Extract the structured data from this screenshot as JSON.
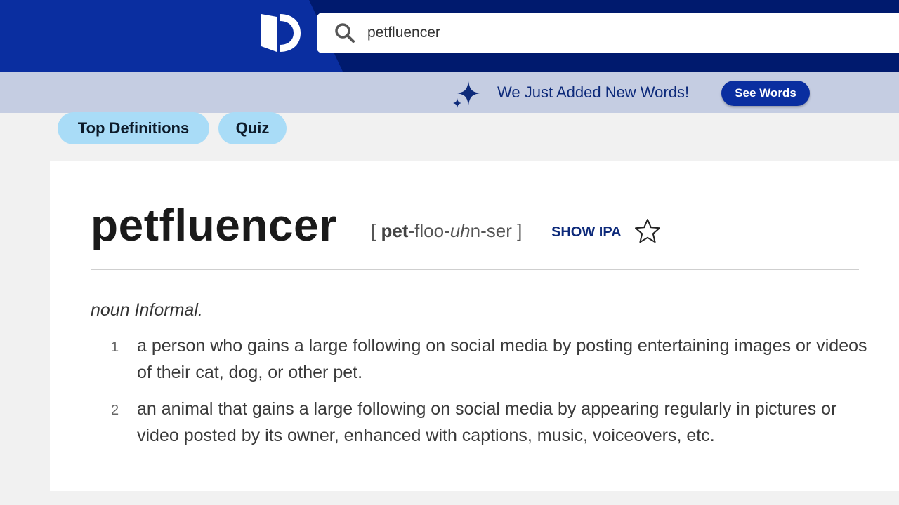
{
  "header": {
    "search": {
      "value": "petfluencer",
      "icon": "search-icon"
    },
    "logo_icon": "dictionary-logo-icon",
    "colors": {
      "primary": "#0a2ea0",
      "dark": "#001a6e"
    }
  },
  "announcement": {
    "icon": "sparkle-icon",
    "text": "We Just Added New Words!",
    "button_label": "See Words"
  },
  "tabs": [
    {
      "label": "Top Definitions"
    },
    {
      "label": "Quiz"
    }
  ],
  "entry": {
    "headword": "petfluencer",
    "pronunciation": {
      "open": "[ ",
      "stressed": "pet",
      "middle": "-floo-",
      "italic": "uh",
      "rest": "n-ser",
      "close": " ]"
    },
    "show_ipa_label": "SHOW IPA",
    "favorite_icon": "star-outline-icon",
    "part_of_speech": "noun Informal.",
    "definitions": [
      {
        "number": "1",
        "text": "a person who gains a large following on social media by posting entertaining images or videos of their cat, dog, or other pet."
      },
      {
        "number": "2",
        "text": "an animal that gains a large following on social media by appearing regularly in pictures or video posted by its owner, enhanced with captions, music, voiceovers, etc."
      }
    ]
  }
}
